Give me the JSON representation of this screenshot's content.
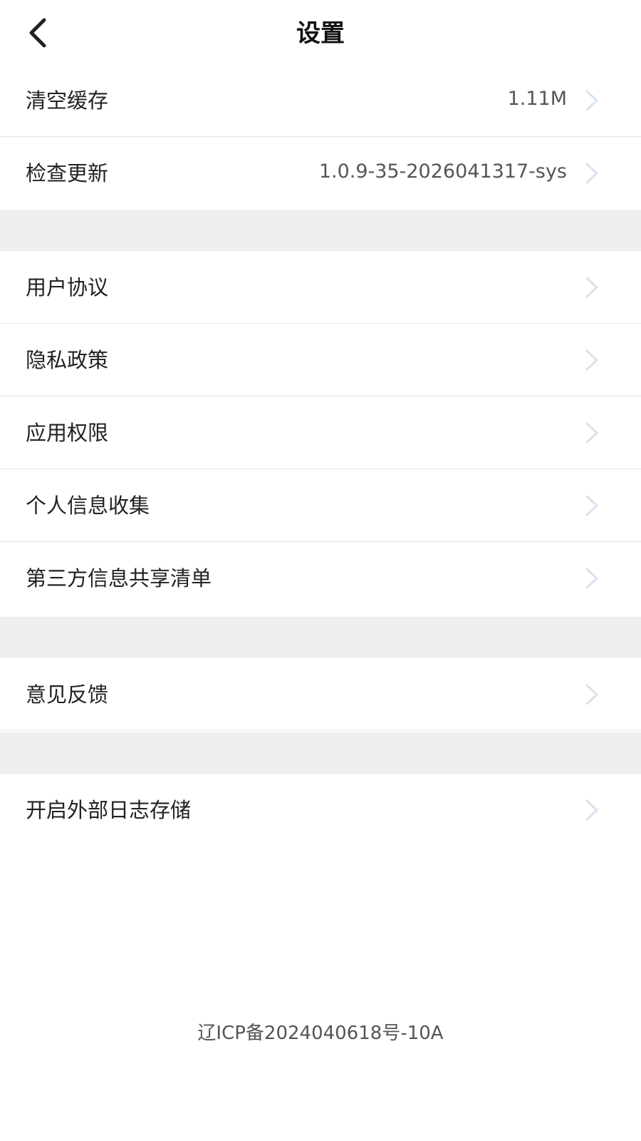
{
  "header": {
    "title": "设置",
    "back_icon": "chevron-left-icon"
  },
  "groups": [
    {
      "items": [
        {
          "label": "清空缓存",
          "value": "1.11M"
        },
        {
          "label": "检查更新",
          "value": "1.0.9-35-2026041317-sys"
        }
      ]
    },
    {
      "items": [
        {
          "label": "用户协议"
        },
        {
          "label": "隐私政策"
        },
        {
          "label": "应用权限"
        },
        {
          "label": "个人信息收集"
        },
        {
          "label": "第三方信息共享清单"
        }
      ]
    },
    {
      "items": [
        {
          "label": "意见反馈"
        }
      ]
    },
    {
      "items": [
        {
          "label": "开启外部日志存储"
        }
      ]
    }
  ],
  "footer": {
    "icp": "辽ICP备2024040618号-10A"
  },
  "colors": {
    "background": "#ffffff",
    "section_gap": "#efefef",
    "divider": "#e6e6e6",
    "chevron": "#d9e3ee"
  }
}
